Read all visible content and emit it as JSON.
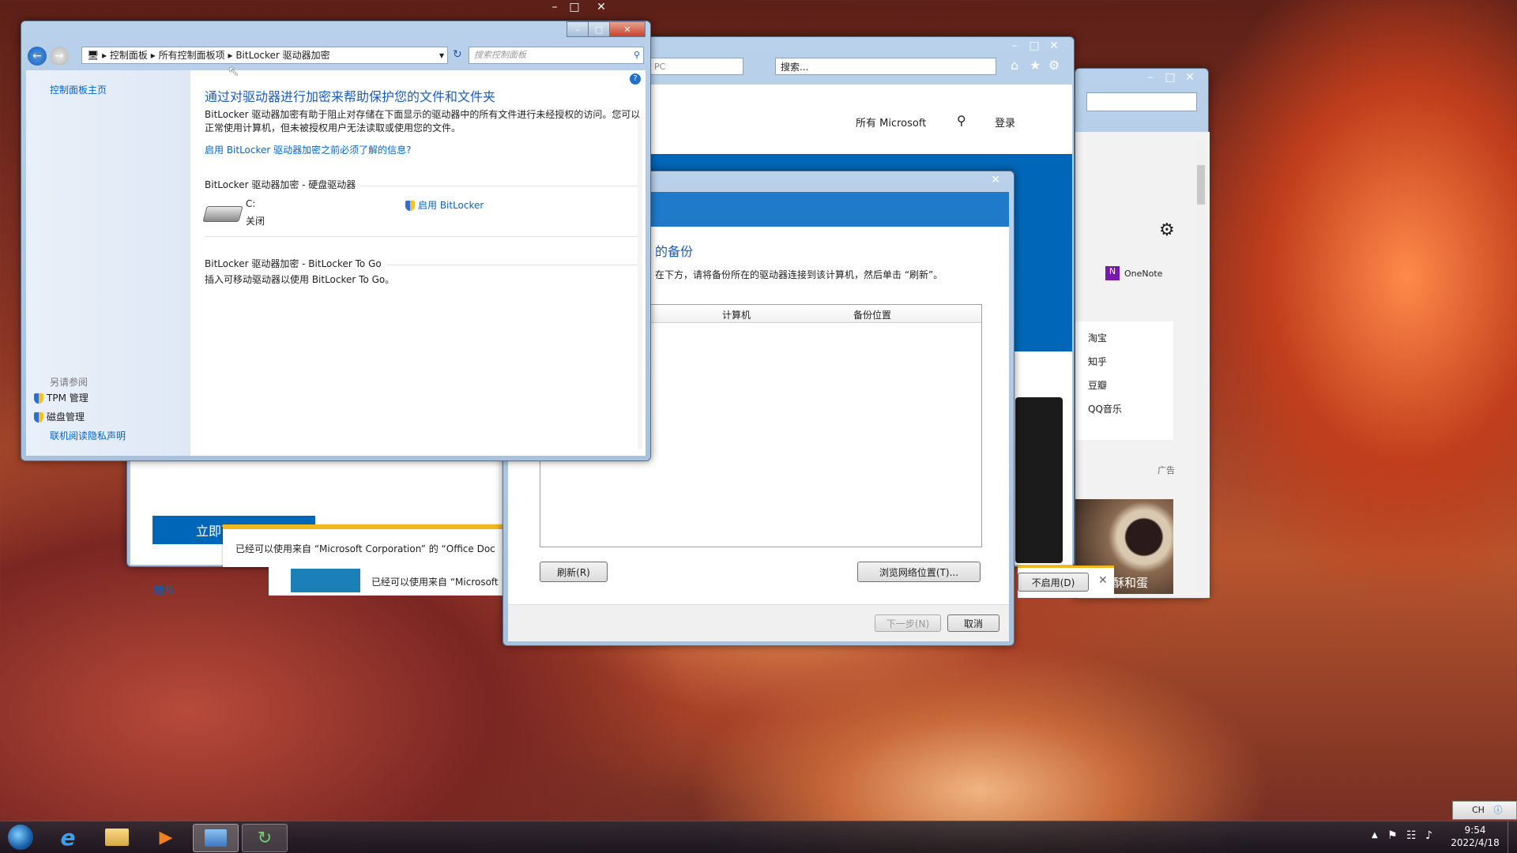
{
  "control_panel": {
    "breadcrumb": [
      "控制面板",
      "所有控制面板项",
      "BitLocker 驱动器加密"
    ],
    "search_placeholder": "搜索控制面板",
    "sidebar_home": "控制面板主页",
    "see_also_title": "另请参阅",
    "see_also": [
      "TPM 管理",
      "磁盘管理"
    ],
    "privacy": "联机阅读隐私声明",
    "heading": "通过对驱动器进行加密来帮助保护您的文件和文件夹",
    "desc": "BitLocker 驱动器加密有助于阻止对存储在下面显示的驱动器中的所有文件进行未经授权的访问。您可以正常使用计算机，但未被授权用户无法读取或使用您的文件。",
    "learn_link": "启用 BitLocker 驱动器加密之前必须了解的信息?",
    "hdd_section": "BitLocker 驱动器加密 - 硬盘驱动器",
    "drive_letter": "C:",
    "drive_status": "关闭",
    "enable_link": "启用 BitLocker",
    "togo_section": "BitLocker 驱动器加密 - BitLocker To Go",
    "togo_desc": "插入可移动驱动器以使用 BitLocker To Go。"
  },
  "browser": {
    "addr_tail": "PC",
    "search_placeholder": "搜索...",
    "nav_all": "所有 Microsoft",
    "login": "登录",
    "download_btn": "立即下载工具",
    "privacy": "隐私",
    "notif1": "已经可以使用来自 “Microsoft Corporation” 的 “Office Doc",
    "notif2": "已经可以使用来自 “Microsoft"
  },
  "dialog": {
    "title_partial": "的备份",
    "instruction": "在下方，请将备份所在的驱动器连接到该计算机，然后单击 “刷新”。",
    "col_computer": "计算机",
    "col_location": "备份位置",
    "refresh": "刷新(R)",
    "browse": "浏览网络位置(T)...",
    "next": "下一步(N)",
    "cancel": "取消"
  },
  "browser2": {
    "onenote": "OneNote",
    "links": [
      "淘宝",
      "知乎",
      "豆瓣",
      "QQ音乐"
    ],
    "ad": "广告",
    "caption": "味的油酥和蛋",
    "disable": "不启用(D)"
  },
  "taskbar": {
    "lang": "CH",
    "time": "9:54",
    "date": "2022/4/18"
  },
  "colors": {
    "accent": "#0067b8",
    "link": "#0066cc",
    "title": "#1e5bb8"
  }
}
